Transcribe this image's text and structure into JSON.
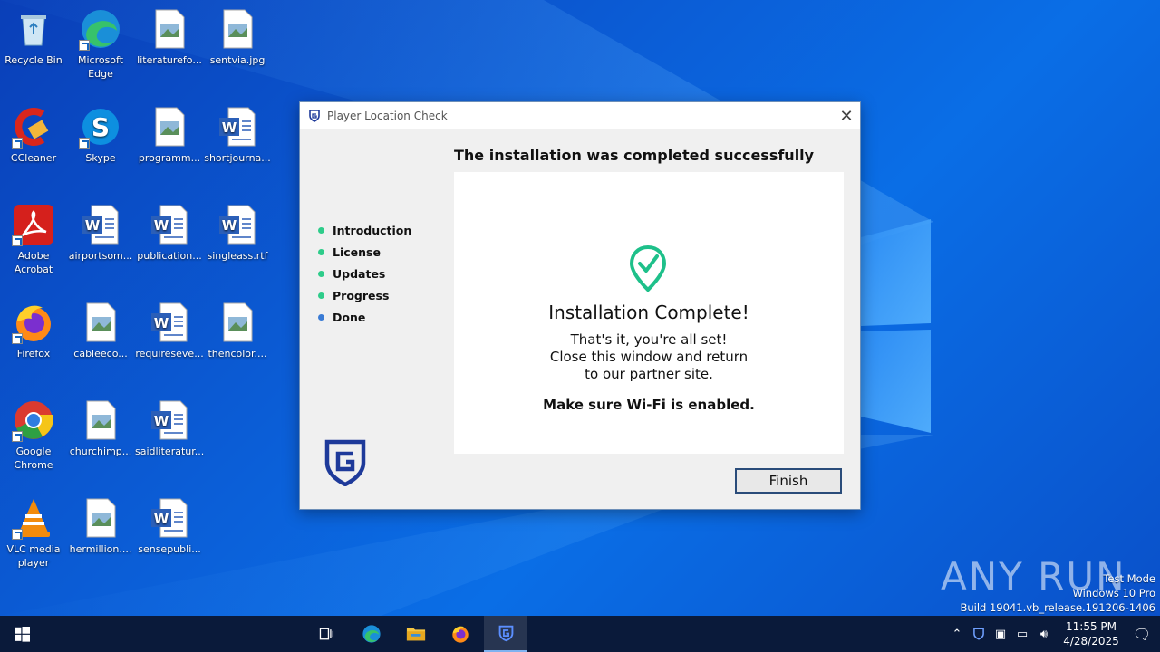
{
  "desktop_icons": [
    {
      "label": "Recycle Bin",
      "icon": "recycle-bin-icon"
    },
    {
      "label": "Microsoft Edge",
      "icon": "edge-icon"
    },
    {
      "label": "literaturefo...",
      "icon": "image-file-icon"
    },
    {
      "label": "sentvia.jpg",
      "icon": "image-file-icon"
    },
    {
      "label": "CCleaner",
      "icon": "ccleaner-icon"
    },
    {
      "label": "Skype",
      "icon": "skype-icon"
    },
    {
      "label": "programm...",
      "icon": "image-file-icon"
    },
    {
      "label": "shortjourna...",
      "icon": "word-file-icon"
    },
    {
      "label": "Adobe Acrobat",
      "icon": "acrobat-icon"
    },
    {
      "label": "airportsom...",
      "icon": "word-file-icon"
    },
    {
      "label": "publication...",
      "icon": "word-file-icon"
    },
    {
      "label": "singleass.rtf",
      "icon": "word-file-icon"
    },
    {
      "label": "Firefox",
      "icon": "firefox-icon"
    },
    {
      "label": "cableeco...",
      "icon": "image-file-icon"
    },
    {
      "label": "requireseve...",
      "icon": "word-file-icon"
    },
    {
      "label": "thencolor....",
      "icon": "image-file-icon"
    },
    {
      "label": "Google Chrome",
      "icon": "chrome-icon"
    },
    {
      "label": "churchimp...",
      "icon": "image-file-icon"
    },
    {
      "label": "saidliteratur...",
      "icon": "word-file-icon"
    },
    {
      "label": "VLC media player",
      "icon": "vlc-icon"
    },
    {
      "label": "hermillion....",
      "icon": "image-file-icon"
    },
    {
      "label": "sensepubli...",
      "icon": "word-file-icon"
    }
  ],
  "dialog": {
    "title": "Player Location Check",
    "heading": "The installation was completed successfully",
    "steps": [
      {
        "label": "Introduction",
        "color": "#2ecc8a"
      },
      {
        "label": "License",
        "color": "#2ecc8a"
      },
      {
        "label": "Updates",
        "color": "#2ecc8a"
      },
      {
        "label": "Progress",
        "color": "#2ecc8a"
      },
      {
        "label": "Done",
        "color": "#3a7bd5"
      }
    ],
    "complete_title": "Installation Complete!",
    "message_lines": [
      "That's it, you're all set!",
      "Close this window and return",
      "to our partner site."
    ],
    "wifi_note": "Make sure Wi-Fi is enabled.",
    "finish_label": "Finish",
    "accent_color": "#1ec08a",
    "brand_color": "#1e3a9a"
  },
  "watermark": {
    "logo_text": "ANY RUN",
    "lines": [
      "Test Mode",
      "Windows 10 Pro",
      "Build 19041.vb_release.191206-1406"
    ]
  },
  "taskbar": {
    "clock_time": "11:55 PM",
    "clock_date": "4/28/2025"
  }
}
